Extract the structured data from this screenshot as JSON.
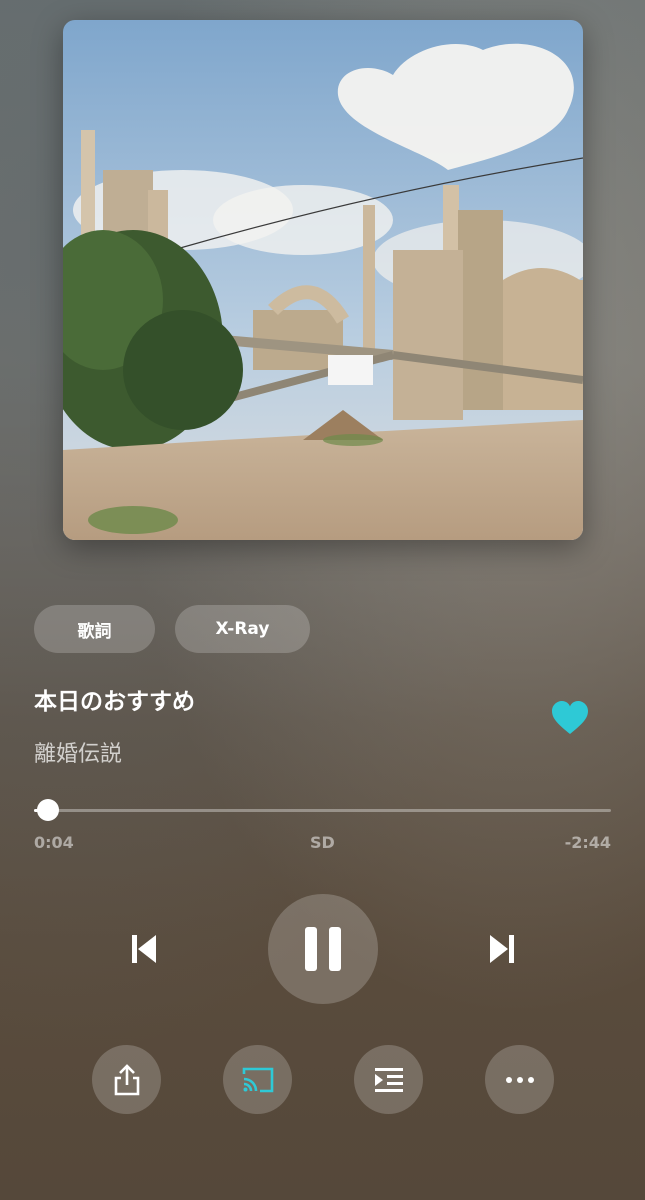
{
  "album": {
    "art_icon": "album-art-industrial-plant-heart-cloud"
  },
  "tabs": {
    "lyrics_label": "歌詞",
    "xray_label": "X-Ray"
  },
  "track": {
    "title": "本日のおすすめ",
    "artist": "離婚伝説",
    "liked": true
  },
  "progress": {
    "elapsed": "0:04",
    "quality": "SD",
    "remaining": "-2:44",
    "fraction": 0.024
  },
  "controls": {
    "previous_icon": "skip-previous-icon",
    "pause_icon": "pause-icon",
    "next_icon": "skip-next-icon",
    "share_icon": "share-icon",
    "cast_icon": "cast-icon",
    "queue_icon": "queue-icon",
    "more_icon": "more-options-icon"
  },
  "colors": {
    "accent": "#2ec9d6",
    "text_primary": "#ffffff"
  }
}
